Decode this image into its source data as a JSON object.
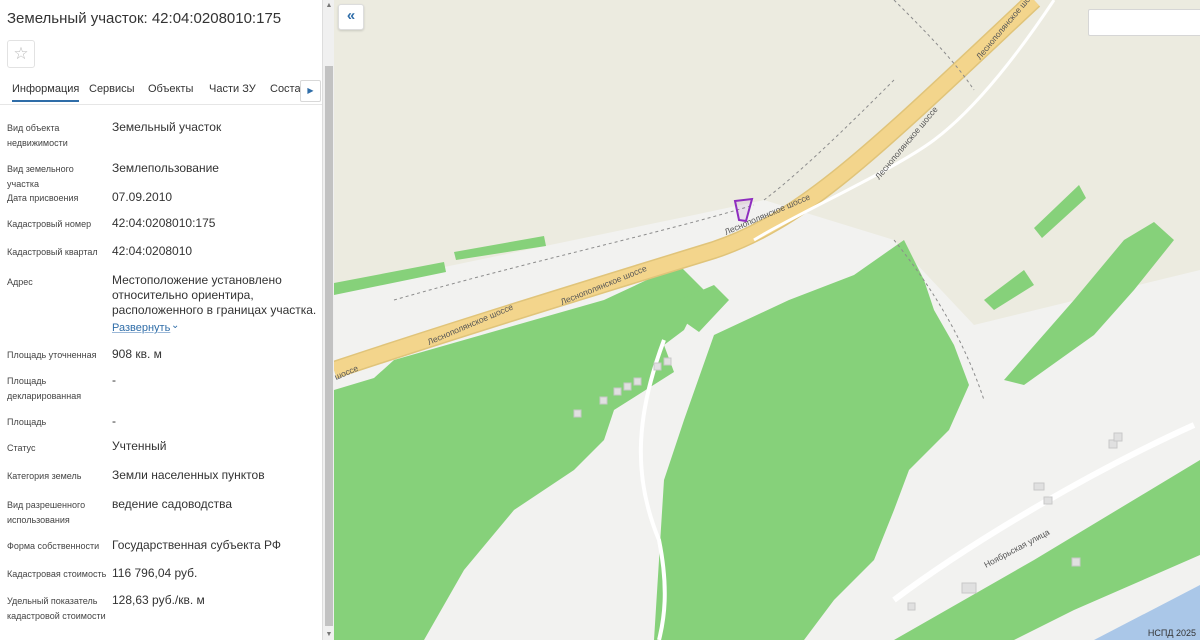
{
  "header": {
    "title": "Земельный участок: 42:04:0208010:175",
    "favorite_icon": "star-outline-icon"
  },
  "tabs": [
    "Информация",
    "Сервисы",
    "Объекты",
    "Части ЗУ",
    "Соста"
  ],
  "info": [
    {
      "label": "Вид объекта недвижимости",
      "value": "Земельный участок"
    },
    {
      "label": "Вид земельного участка",
      "value": "Землепользование"
    },
    {
      "label": "Дата присвоения",
      "value": "07.09.2010"
    },
    {
      "label": "Кадастровый номер",
      "value": "42:04:0208010:175"
    },
    {
      "label": "Кадастровый квартал",
      "value": "42:04:0208010"
    },
    {
      "label": "Адрес",
      "value": "Местоположение установлено относительно ориентира, расположенного в границах участка."
    },
    {
      "label": "Площадь уточненная",
      "value": "908 кв. м"
    },
    {
      "label": "Площадь декларированная",
      "value": "-"
    },
    {
      "label": "Площадь",
      "value": "-"
    },
    {
      "label": "Статус",
      "value": "Учтенный"
    },
    {
      "label": "Категория земель",
      "value": "Земли населенных пунктов"
    },
    {
      "label": "Вид разрешенного использования",
      "value": "ведение садоводства"
    },
    {
      "label": "Форма собственности",
      "value": "Государственная субъекта РФ"
    },
    {
      "label": "Кадастровая стоимость",
      "value": "116 796,04 руб."
    },
    {
      "label": "Удельный показатель кадастровой стоимости",
      "value": "128,63 руб./кв. м"
    }
  ],
  "expand_link": "Развернуть",
  "map": {
    "road_label": "Леснополянское шоссе",
    "road_label_edge": "шоссе",
    "street_label": "Ноябрьская улица",
    "copyright": "НСПД 2025",
    "collapse_icon": "double-chevron-left-icon"
  },
  "colors": {
    "accent": "#2f6da8",
    "forest": "#86d17a",
    "road": "#f3d58c",
    "water": "#aac7e8",
    "parcel": "#8e2dbf"
  }
}
